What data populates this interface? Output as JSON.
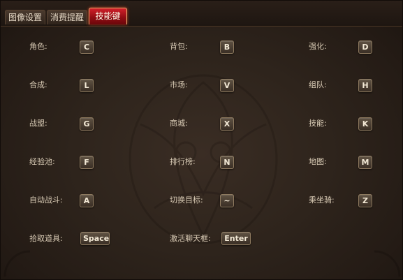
{
  "tabs": [
    {
      "label": "图像设置",
      "active": false
    },
    {
      "label": "消费提醒",
      "active": false
    },
    {
      "label": "技能键",
      "active": true
    }
  ],
  "hotkeys": [
    {
      "label": "角色:",
      "key": "C"
    },
    {
      "label": "背包:",
      "key": "B"
    },
    {
      "label": "强化:",
      "key": "D"
    },
    {
      "label": "合成:",
      "key": "L"
    },
    {
      "label": "市场:",
      "key": "V"
    },
    {
      "label": "组队:",
      "key": "H"
    },
    {
      "label": "战盟:",
      "key": "G"
    },
    {
      "label": "商城:",
      "key": "X"
    },
    {
      "label": "技能:",
      "key": "K"
    },
    {
      "label": "经验池:",
      "key": "F"
    },
    {
      "label": "排行榜:",
      "key": "N"
    },
    {
      "label": "地图:",
      "key": "M"
    },
    {
      "label": "自动战斗:",
      "key": "A"
    },
    {
      "label": "切换目标:",
      "key": "~"
    },
    {
      "label": "乘坐骑:",
      "key": "Z"
    },
    {
      "label": "拾取道具:",
      "key": "Space"
    },
    {
      "label": "激活聊天框:",
      "key": "Enter"
    }
  ],
  "colors": {
    "active_tab": "#b3141c",
    "key_bg": "#4e4236",
    "text": "#d9cbb5"
  }
}
